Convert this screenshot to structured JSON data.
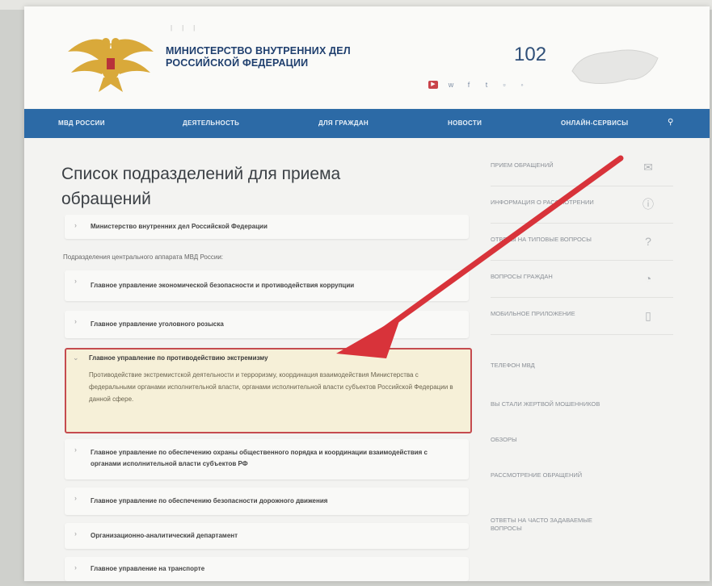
{
  "header": {
    "toplinks": [
      "",
      "",
      "",
      ""
    ],
    "ministry_title": "МИНИСТЕРСТВО ВНУТРЕННИХ ДЕЛ РОССИЙСКОЙ ФЕДЕРАЦИИ",
    "ministry_sub": "",
    "lang": [
      "",
      ""
    ],
    "hotline": "",
    "phone": "102",
    "map_label": ""
  },
  "nav": {
    "items": [
      "МВД РОССИИ",
      "ДЕЯТЕЛЬНОСТЬ",
      "ДЛЯ ГРАЖДАН",
      "НОВОСТИ",
      "ОНЛАЙН-СЕРВИСЫ"
    ]
  },
  "content": {
    "title": "Список подразделений для приема обращений",
    "top_item": "Министерство внутренних дел Российской Федерации",
    "section_label": "Подразделения центрального аппарата МВД России:",
    "items": [
      "Главное управление экономической безопасности и противодействия коррупции",
      "Главное управление уголовного розыска"
    ],
    "highlight": {
      "title": "Главное управление по противодействию экстремизму",
      "desc": "Противодействие экстремистской деятельности и терроризму, координация взаимодействия Министерства с федеральными органами исполнительной власти, органами исполнительной власти субъектов Российской Федерации в данной сфере."
    },
    "items_after": [
      "Главное управление по обеспечению охраны общественного порядка и координации взаимодействия с органами исполнительной власти субъектов РФ",
      "Главное управление по обеспечению безопасности дорожного движения",
      "Организационно-аналитический департамент",
      "Главное управление на транспорте"
    ]
  },
  "sidebar": {
    "rows": [
      {
        "label": "ПРИЕМ ОБРАЩЕНИЙ",
        "icon": "envelope-icon"
      },
      {
        "label": "ИНФОРМАЦИЯ О РАССМОТРЕНИИ",
        "icon": "info-icon"
      },
      {
        "label": "ОТВЕТЫ НА ТИПОВЫЕ ВОПРОСЫ",
        "icon": "question-icon"
      },
      {
        "label": "ВОПРОСЫ ГРАЖДАН",
        "icon": "chat-icon"
      },
      {
        "label": "МОБИЛЬНОЕ ПРИЛОЖЕНИЕ",
        "icon": "phone-icon"
      }
    ],
    "plain": [
      "ТЕЛЕФОН МВД",
      "ВЫ СТАЛИ ЖЕРТВОЙ МОШЕННИКОВ",
      "ОБЗОРЫ",
      "РАССМОТРЕНИЕ ОБРАЩЕНИЙ",
      "ОТВЕТЫ НА ЧАСТО ЗАДАВАЕМЫЕ ВОПРОСЫ"
    ]
  },
  "colors": {
    "nav": "#2c6aa6",
    "title": "#1f3f6e",
    "highlight_border": "#c54b4f",
    "highlight_bg": "#f6f0d8",
    "arrow": "#d8333a"
  }
}
